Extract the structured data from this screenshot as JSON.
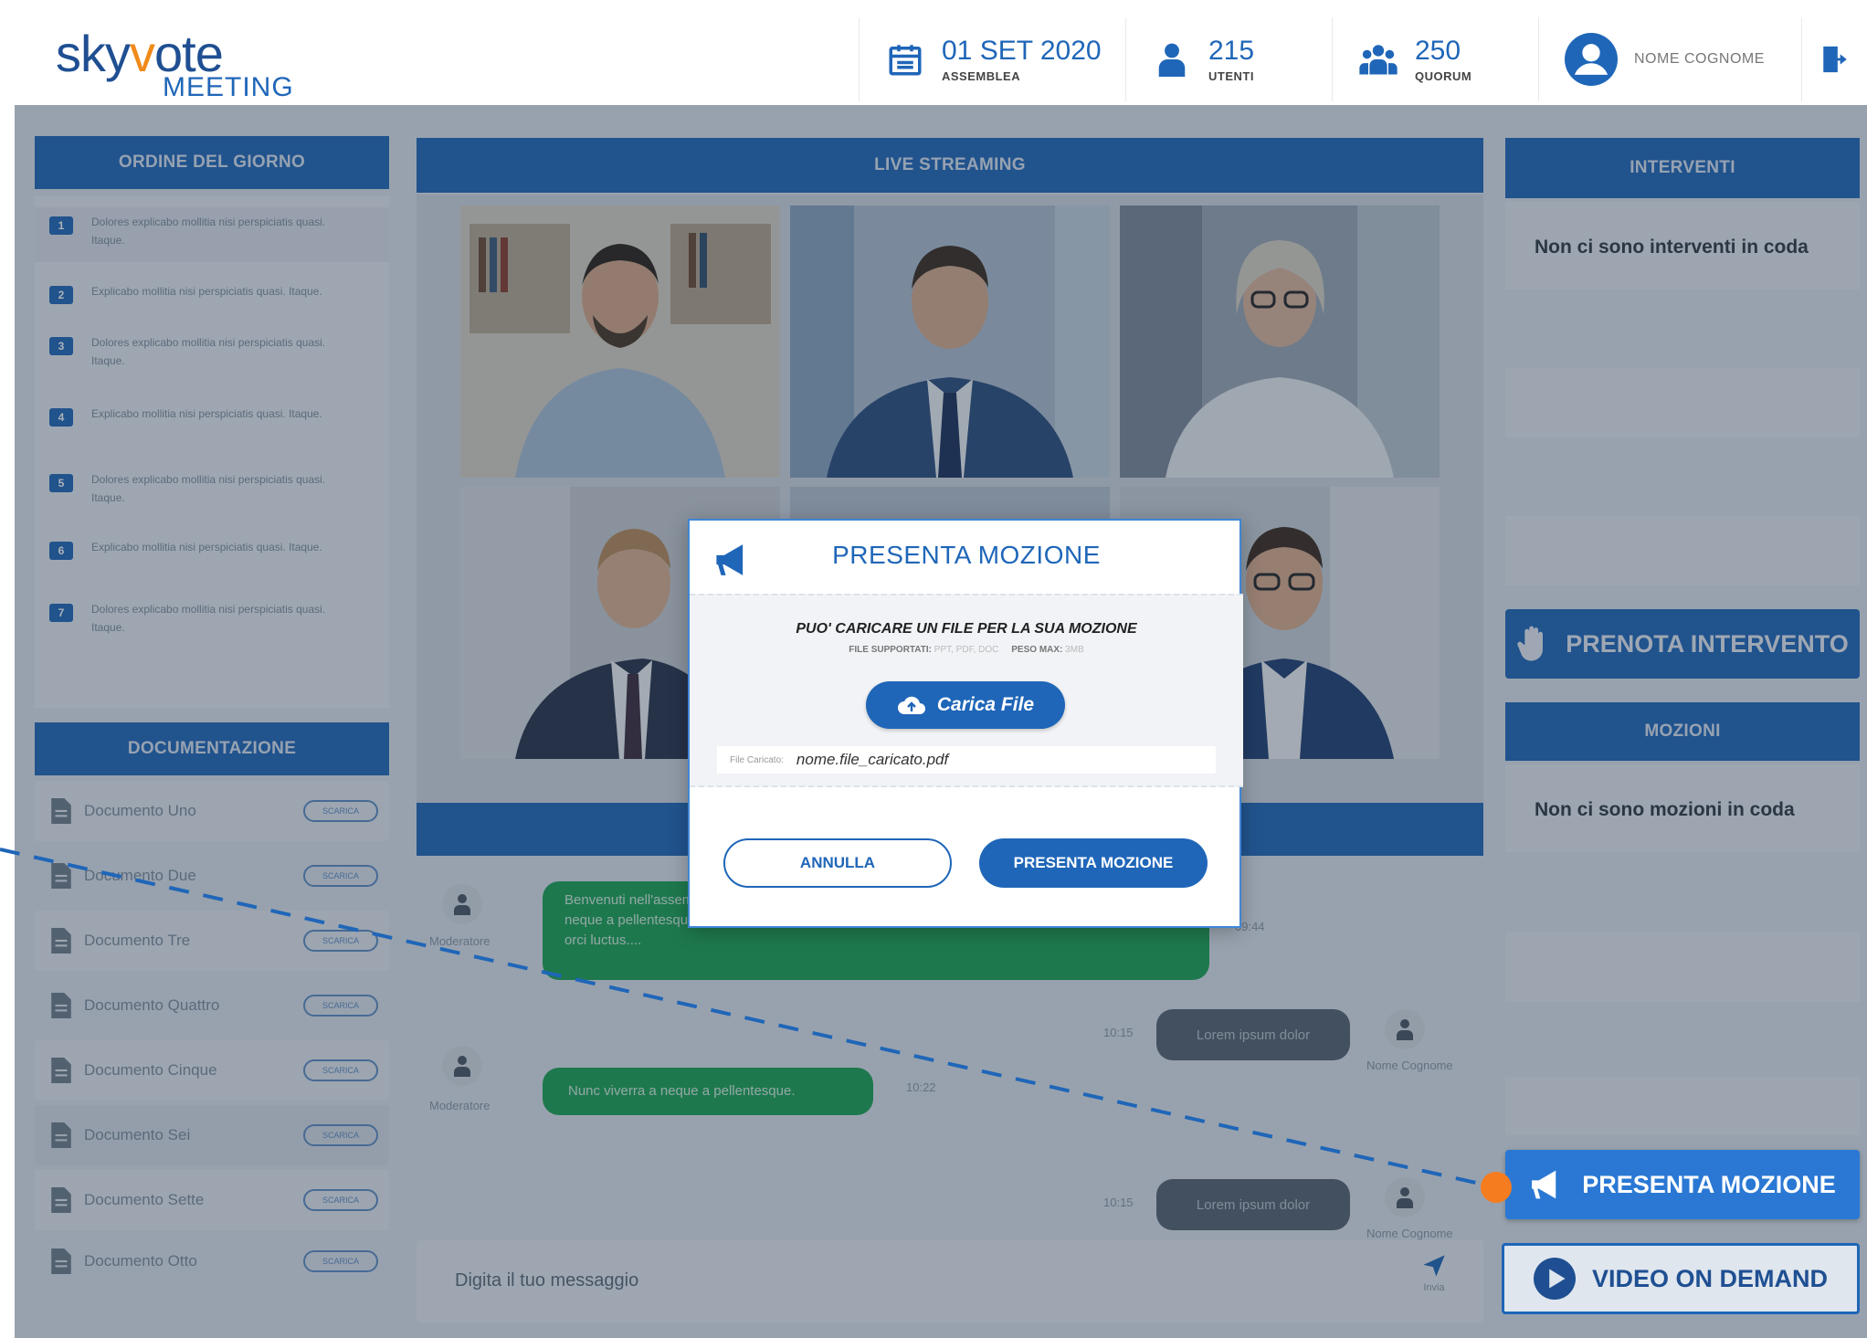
{
  "logo": {
    "sky": "sky",
    "v": "v",
    "ote": "ote",
    "sub": "MEETING"
  },
  "header": {
    "date": {
      "value": "01 SET 2020",
      "label": "ASSEMBLEA"
    },
    "users": {
      "value": "215",
      "label": "UTENTI"
    },
    "quorum": {
      "value": "250",
      "label": "QUORUM"
    },
    "user_name": "NOME COGNOME"
  },
  "agenda": {
    "title": "ORDINE DEL GIORNO",
    "items": [
      {
        "num": "1",
        "text": "Dolores explicabo mollitia nisi perspiciatis quasi. Itaque."
      },
      {
        "num": "2",
        "text": "Explicabo mollitia nisi perspiciatis quasi. Itaque."
      },
      {
        "num": "3",
        "text": "Dolores explicabo mollitia nisi perspiciatis quasi. Itaque."
      },
      {
        "num": "4",
        "text": "Explicabo mollitia nisi perspiciatis quasi. Itaque."
      },
      {
        "num": "5",
        "text": "Dolores explicabo mollitia nisi perspiciatis quasi. Itaque."
      },
      {
        "num": "6",
        "text": "Explicabo mollitia nisi perspiciatis quasi. Itaque."
      },
      {
        "num": "7",
        "text": "Dolores explicabo mollitia nisi perspiciatis quasi. Itaque."
      }
    ]
  },
  "docs": {
    "title": "DOCUMENTAZIONE",
    "download_label": "SCARICA",
    "items": [
      "Documento Uno",
      "Documento Due",
      "Documento Tre",
      "Documento Quattro",
      "Documento Cinque",
      "Documento Sei",
      "Documento Sette",
      "Documento Otto"
    ]
  },
  "stream": {
    "title": "LIVE STREAMING"
  },
  "chat": {
    "messages": [
      {
        "author": "Moderatore",
        "text": "Benvenuti nell'assemblea. Lorem ipsum dolor sit amet, consectetur adipiscing elit. Nunc viverra a neque a pellentesque. uspendisse rutrum id tellus at congue. Vestibulum ante ipsum primis in faucibus orci luctus....",
        "time": "09:44"
      },
      {
        "author": "Nome Cognome",
        "text": "Lorem ipsum dolor",
        "time": "10:15"
      },
      {
        "author": "Moderatore",
        "text": "Nunc viverra a neque a pellentesque.",
        "time": "10:22"
      },
      {
        "author": "Nome Cognome",
        "text": "Lorem ipsum dolor",
        "time": "10:15"
      }
    ],
    "input_placeholder": "Digita il tuo messaggio",
    "send_label": "Invia"
  },
  "interventi": {
    "title": "INTERVENTI",
    "empty": "Non ci sono interventi in coda",
    "button": "PRENOTA INTERVENTO"
  },
  "mozioni": {
    "title": "MOZIONI",
    "empty": "Non ci sono mozioni in coda",
    "button": "PRESENTA MOZIONE"
  },
  "vod": {
    "button": "VIDEO ON DEMAND"
  },
  "modal": {
    "title": "PRESENTA MOZIONE",
    "upload_title": "PUO' CARICARE UN FILE PER LA SUA MOZIONE",
    "types_label": "FILE SUPPORTATI:",
    "types": "PPT, PDF, DOC",
    "max_label": "PESO MAX:",
    "max": "3MB",
    "upload_button": "Carica File",
    "file_label": "File Caricato:",
    "file_name": "nome.file_caricato.pdf",
    "cancel": "ANNULLA",
    "submit": "PRESENTA MOZIONE"
  },
  "colors": {
    "primary": "#1f66b8",
    "accent": "#f08a1a",
    "green": "#1aa253"
  }
}
